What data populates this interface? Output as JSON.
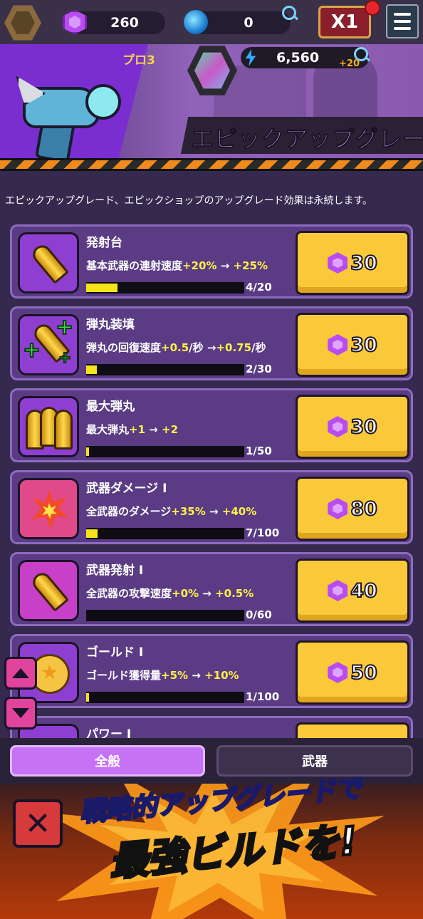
{
  "topbar": {
    "gems": "260",
    "orbs": "0",
    "speed": "X1"
  },
  "banner": {
    "rank": "プロ3",
    "power": "6,560",
    "power_bonus": "+20",
    "title": "エピックアップグレー"
  },
  "description": "エピックアップグレード、エピックショップのアップグレード効果は永続します。",
  "upgrades": [
    {
      "name": "発射台",
      "effect_prefix": "基本武器の連射速度",
      "from": "+20%",
      "arrow": " → ",
      "to": "+25%",
      "effect_suffix": "",
      "progress": "4/20",
      "fraction": 0.2,
      "price": "30",
      "icon": "bullet-icon"
    },
    {
      "name": "弾丸装填",
      "effect_prefix": "弾丸の回復速度",
      "from": "+0.5",
      "arrow": "/秒 →",
      "to": "+0.75",
      "effect_suffix": "/秒",
      "progress": "2/30",
      "fraction": 0.0667,
      "price": "30",
      "icon": "reload-icon"
    },
    {
      "name": "最大弾丸",
      "effect_prefix": "最大弾丸",
      "from": "+1",
      "arrow": " → ",
      "to": "+2",
      "effect_suffix": "",
      "progress": "1/50",
      "fraction": 0.02,
      "price": "30",
      "icon": "ammo-icon"
    },
    {
      "name": "武器ダメージ I",
      "effect_prefix": "全武器のダメージ",
      "from": "+35%",
      "arrow": " → ",
      "to": "+40%",
      "effect_suffix": "",
      "progress": "7/100",
      "fraction": 0.07,
      "price": "80",
      "icon": "explosion-icon"
    },
    {
      "name": "武器発射 I",
      "effect_prefix": "全武器の攻撃速度",
      "from": "+0%",
      "arrow": " → ",
      "to": "+0.5%",
      "effect_suffix": "",
      "progress": "0/60",
      "fraction": 0.0,
      "price": "40",
      "icon": "bullet-icon"
    },
    {
      "name": "ゴールド I",
      "effect_prefix": "ゴールド獲得量",
      "from": "+5%",
      "arrow": " → ",
      "to": "+10%",
      "effect_suffix": "",
      "progress": "1/100",
      "fraction": 0.01,
      "price": "50",
      "icon": "coin-icon"
    },
    {
      "name": "パワー I"
    }
  ],
  "tabs": {
    "general": "全般",
    "weapons": "武器"
  },
  "promo": {
    "line1": "戦略的アップグレードで",
    "line2": "最強ビルドを!"
  }
}
